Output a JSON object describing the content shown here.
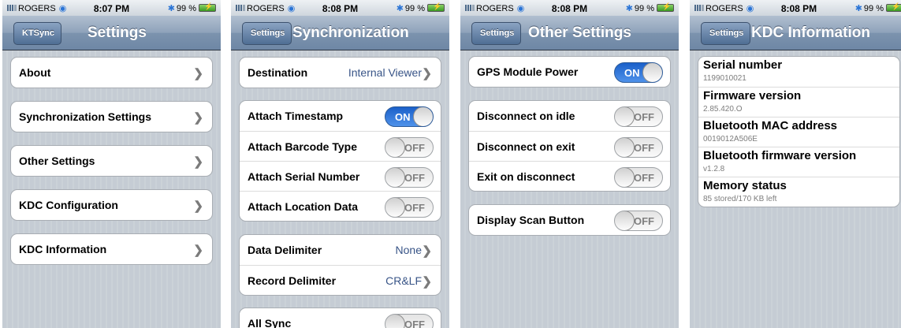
{
  "screens": [
    {
      "status": {
        "carrier": "ROGERS",
        "time": "8:07 PM",
        "battery": "99 %"
      },
      "nav": {
        "title": "Settings",
        "back": "KTSync"
      },
      "items": [
        "About",
        "Synchronization Settings",
        "Other Settings",
        "KDC Configuration",
        "KDC Information"
      ]
    },
    {
      "status": {
        "carrier": "ROGERS",
        "time": "8:08 PM",
        "battery": "99 %"
      },
      "nav": {
        "title": "Synchronization",
        "back": "Settings"
      },
      "destination": {
        "label": "Destination",
        "value": "Internal Viewer"
      },
      "toggles": [
        {
          "label": "Attach Timestamp",
          "state": "ON"
        },
        {
          "label": "Attach Barcode Type",
          "state": "OFF"
        },
        {
          "label": "Attach Serial Number",
          "state": "OFF"
        },
        {
          "label": "Attach Location Data",
          "state": "OFF"
        }
      ],
      "delimiters": [
        {
          "label": "Data Delimiter",
          "value": "None"
        },
        {
          "label": "Record Delimiter",
          "value": "CR&LF"
        }
      ],
      "all_sync": {
        "label": "All Sync",
        "state": "OFF"
      }
    },
    {
      "status": {
        "carrier": "ROGERS",
        "time": "8:08 PM",
        "battery": "99 %"
      },
      "nav": {
        "title": "Other Settings",
        "back": "Settings"
      },
      "gps": {
        "label": "GPS Module Power",
        "state": "ON"
      },
      "disconnect": [
        {
          "label": "Disconnect on idle",
          "state": "OFF"
        },
        {
          "label": "Disconnect on exit",
          "state": "OFF"
        },
        {
          "label": "Exit on disconnect",
          "state": "OFF"
        }
      ],
      "scan_button": {
        "label": "Display Scan Button",
        "state": "OFF"
      }
    },
    {
      "status": {
        "carrier": "ROGERS",
        "time": "8:08 PM",
        "battery": "99 %"
      },
      "nav": {
        "title": "KDC Information",
        "back": "Settings"
      },
      "info": [
        {
          "title": "Serial number",
          "value": "1199010021"
        },
        {
          "title": "Firmware version",
          "value": "2.85.420.O"
        },
        {
          "title": "Bluetooth MAC address",
          "value": "0019012A506E"
        },
        {
          "title": "Bluetooth firmware version",
          "value": "v1.2.8"
        },
        {
          "title": "Memory status",
          "value": "85 stored/170 KB left"
        }
      ]
    }
  ]
}
